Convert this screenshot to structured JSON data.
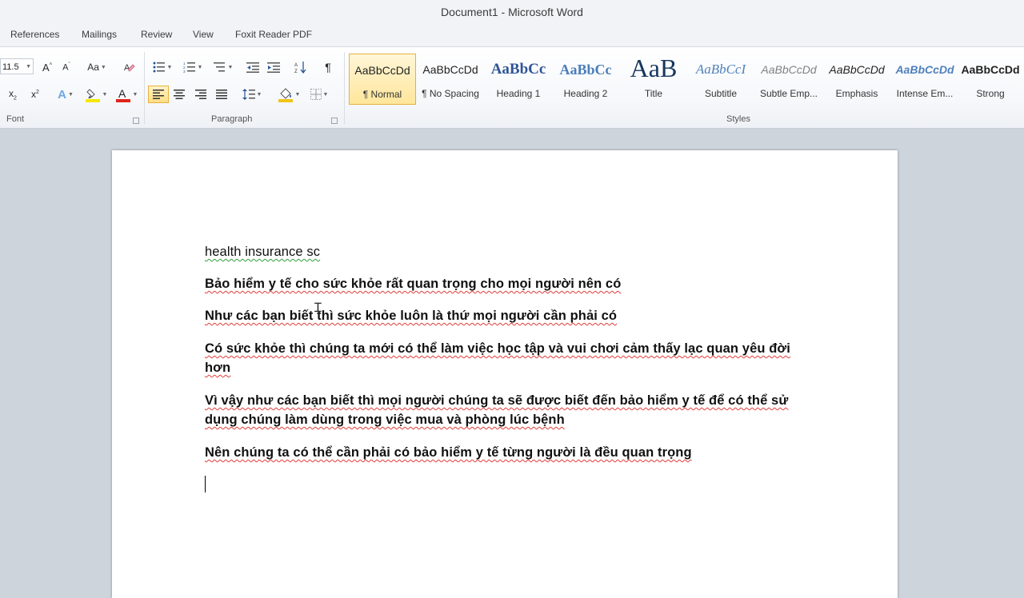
{
  "window": {
    "title": "Document1 - Microsoft Word"
  },
  "tabs": [
    "References",
    "Mailings",
    "Review",
    "View",
    "Foxit Reader PDF"
  ],
  "font_group": {
    "font_size": "11.5",
    "label": "Font",
    "icons": [
      "grow-font-icon",
      "shrink-font-icon",
      "change-case-icon",
      "clear-formatting-icon",
      "subscript-icon",
      "superscript-icon",
      "text-effects-icon",
      "highlight-color-icon",
      "font-color-icon"
    ]
  },
  "paragraph_group": {
    "label": "Paragraph",
    "icons": [
      "bullets-icon",
      "numbering-icon",
      "multilevel-list-icon",
      "decrease-indent-icon",
      "increase-indent-icon",
      "sort-icon",
      "show-formatting-marks-icon",
      "align-left-icon",
      "center-icon",
      "align-right-icon",
      "justify-icon",
      "line-spacing-icon",
      "shading-icon",
      "borders-icon"
    ]
  },
  "styles_group": {
    "label": "Styles",
    "items": [
      {
        "sample": "AaBbCcDd",
        "name": "¶ Normal",
        "selected": true
      },
      {
        "sample": "AaBbCcDd",
        "name": "¶ No Spacing"
      },
      {
        "sample": "AaBbCc",
        "name": "Heading 1"
      },
      {
        "sample": "AaBbCc",
        "name": "Heading 2"
      },
      {
        "sample": "AaB",
        "name": "Title"
      },
      {
        "sample": "AaBbCcI",
        "name": "Subtitle"
      },
      {
        "sample": "AaBbCcDd",
        "name": "Subtle Emp..."
      },
      {
        "sample": "AaBbCcDd",
        "name": "Emphasis"
      },
      {
        "sample": "AaBbCcDd",
        "name": "Intense Em..."
      },
      {
        "sample": "AaBbCcDd",
        "name": "Strong"
      }
    ]
  },
  "colors": {
    "highlight": "#f5e800",
    "font_color": "#e0241c",
    "selected_style_border": "#e7b13d",
    "heading_blue": "#2f5597"
  },
  "document": {
    "paragraphs": [
      "health insurance sc",
      "Bảo hiểm y tế cho sức khỏe rất quan trọng cho mọi người nên có",
      "Như các bạn biết thì sức khỏe luôn là thứ mọi người cần phải có",
      "Có sức khỏe thì chúng ta mới có thể làm việc học tập và vui chơi cảm thấy lạc quan yêu đời hơn",
      "Vì vậy như các bạn biết thì mọi người chúng ta sẽ được biết đến bảo hiểm y tế để có thể sử dụng chúng làm dùng trong việc mua và phòng lúc bệnh",
      "Nên chúng ta có thể cần phải có bảo hiểm y tế từng người là đều quan trọng"
    ]
  }
}
